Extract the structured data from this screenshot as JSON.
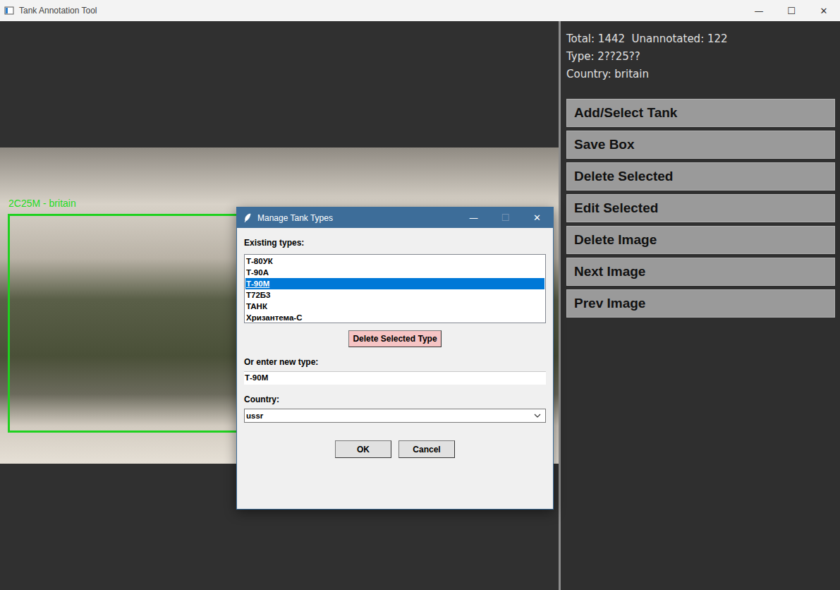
{
  "window": {
    "title": "Tank Annotation Tool",
    "controls": [
      {
        "glyph": "—",
        "disabled": false
      },
      {
        "glyph": "☐",
        "disabled": false
      },
      {
        "glyph": "✕",
        "disabled": false
      }
    ]
  },
  "canvas": {
    "annotations": [
      {
        "label": "2C25M - britain"
      }
    ]
  },
  "info": {
    "lines": [
      "Total: 1442  Unannotated: 122",
      "Type: 2??25??",
      "Country: britain"
    ]
  },
  "buttons": [
    "Add/Select Tank",
    "Save Box",
    "Delete Selected",
    "Edit Selected",
    "Delete Image",
    "Next Image",
    "Prev Image"
  ],
  "dialog": {
    "title": "Manage Tank Types",
    "controls": [
      {
        "glyph": "—",
        "disabled": false
      },
      {
        "glyph": "☐",
        "disabled": true
      },
      {
        "glyph": "✕",
        "disabled": false
      }
    ],
    "existing_label": "Existing types:",
    "types": [
      {
        "label": "Т-80УК",
        "selected": false
      },
      {
        "label": "Т-90А",
        "selected": false
      },
      {
        "label": "Т-90М",
        "selected": true
      },
      {
        "label": "Т72Б3",
        "selected": false
      },
      {
        "label": "ТАНК",
        "selected": false
      },
      {
        "label": "Хризантема-С",
        "selected": false
      }
    ],
    "delete_button": "Delete Selected Type",
    "new_type_label": "Or enter new type:",
    "new_type_value": "Т-90М",
    "country_label": "Country:",
    "country_value": "ussr",
    "buttons": [
      "OK",
      "Cancel"
    ]
  }
}
